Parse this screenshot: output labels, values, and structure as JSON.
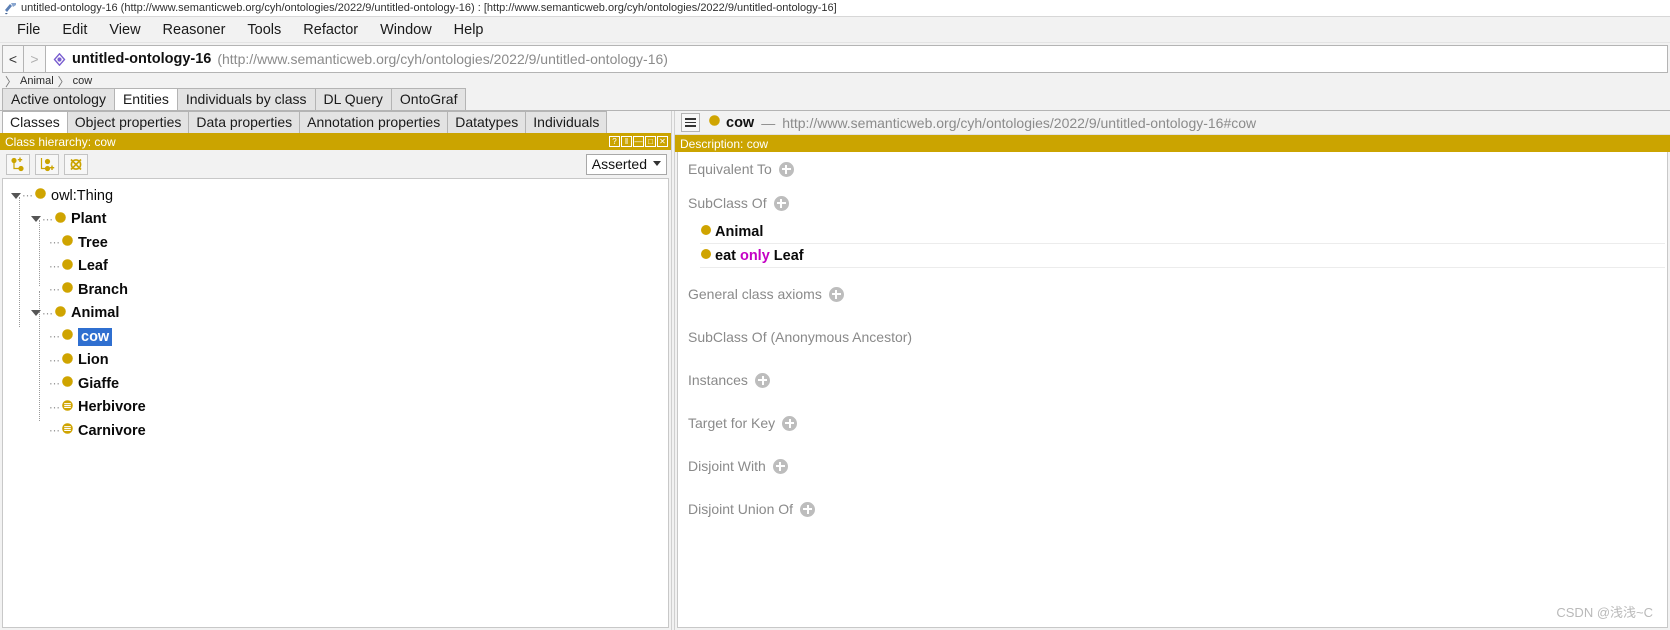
{
  "window": {
    "title": "untitled-ontology-16 (http://www.semanticweb.org/cyh/ontologies/2022/9/untitled-ontology-16)  : [http://www.semanticweb.org/cyh/ontologies/2022/9/untitled-ontology-16]",
    "app_icon": "protege-icon"
  },
  "menubar": {
    "items": [
      {
        "label": "File"
      },
      {
        "label": "Edit"
      },
      {
        "label": "View"
      },
      {
        "label": "Reasoner"
      },
      {
        "label": "Tools"
      },
      {
        "label": "Refactor"
      },
      {
        "label": "Window"
      },
      {
        "label": "Help"
      }
    ]
  },
  "iri_bar": {
    "back_label": "<",
    "forward_label": ">",
    "ontology_name": "untitled-ontology-16",
    "ontology_iri": "(http://www.semanticweb.org/cyh/ontologies/2022/9/untitled-ontology-16)"
  },
  "breadcrumb": {
    "sep": "〉",
    "items": [
      {
        "label": "Animal"
      },
      {
        "label": "cow"
      }
    ]
  },
  "tabs": {
    "items": [
      {
        "label": "Active ontology",
        "active": false
      },
      {
        "label": "Entities",
        "active": true
      },
      {
        "label": "Individuals by class",
        "active": false
      },
      {
        "label": "DL Query",
        "active": false
      },
      {
        "label": "OntoGraf",
        "active": false
      }
    ]
  },
  "subtabs": {
    "items": [
      {
        "label": "Classes",
        "active": true
      },
      {
        "label": "Object properties",
        "active": false
      },
      {
        "label": "Data properties",
        "active": false
      },
      {
        "label": "Annotation properties",
        "active": false
      },
      {
        "label": "Datatypes",
        "active": false
      },
      {
        "label": "Individuals",
        "active": false
      }
    ]
  },
  "class_hierarchy": {
    "header_title": "Class hierarchy: cow",
    "header_buttons": [
      "?",
      "‖",
      "—",
      "□",
      "✕"
    ],
    "toolbar": [
      {
        "name": "add-subclass-button",
        "icon": "add-subclass-icon"
      },
      {
        "name": "add-sibling-class-button",
        "icon": "add-sibling-icon"
      },
      {
        "name": "delete-class-button",
        "icon": "delete-class-icon"
      }
    ],
    "view_mode": "Asserted",
    "tree": [
      {
        "label": "owl:Thing",
        "depth": 0,
        "bold": false,
        "expanded": true,
        "icon": "class-icon",
        "selected": false
      },
      {
        "label": "Plant",
        "depth": 1,
        "bold": true,
        "expanded": true,
        "icon": "class-icon",
        "selected": false
      },
      {
        "label": "Tree",
        "depth": 2,
        "bold": true,
        "expanded": false,
        "icon": "class-icon",
        "selected": false
      },
      {
        "label": "Leaf",
        "depth": 2,
        "bold": true,
        "expanded": false,
        "icon": "class-icon",
        "selected": false
      },
      {
        "label": "Branch",
        "depth": 2,
        "bold": true,
        "expanded": false,
        "icon": "class-icon",
        "selected": false
      },
      {
        "label": "Animal",
        "depth": 1,
        "bold": true,
        "expanded": true,
        "icon": "class-icon",
        "selected": false
      },
      {
        "label": "cow",
        "depth": 2,
        "bold": true,
        "expanded": false,
        "icon": "class-icon",
        "selected": true
      },
      {
        "label": "Lion",
        "depth": 2,
        "bold": true,
        "expanded": false,
        "icon": "class-icon",
        "selected": false
      },
      {
        "label": "Giaffe",
        "depth": 2,
        "bold": true,
        "expanded": false,
        "icon": "class-icon",
        "selected": false
      },
      {
        "label": "Herbivore",
        "depth": 2,
        "bold": true,
        "expanded": false,
        "icon": "defined-class-icon",
        "selected": false
      },
      {
        "label": "Carnivore",
        "depth": 2,
        "bold": true,
        "expanded": false,
        "icon": "defined-class-icon",
        "selected": false
      }
    ]
  },
  "entity_bar": {
    "menu_icon": "hamburger-icon",
    "entity_icon": "class-icon",
    "entity_name": "cow",
    "dash": "—",
    "entity_iri": "http://www.semanticweb.org/cyh/ontologies/2022/9/untitled-ontology-16#cow"
  },
  "description": {
    "header_title": "Description: cow",
    "sections": [
      {
        "title": "Equivalent To",
        "has_add": true,
        "rows": []
      },
      {
        "title": "SubClass Of",
        "has_add": true,
        "rows": [
          {
            "parts": [
              {
                "text": "Animal",
                "kind": "entity"
              }
            ]
          },
          {
            "parts": [
              {
                "text": "eat",
                "kind": "entity"
              },
              {
                "text": "only",
                "kind": "keyword"
              },
              {
                "text": "Leaf",
                "kind": "entity"
              }
            ]
          }
        ]
      },
      {
        "title": "General class axioms",
        "has_add": true,
        "rows": []
      },
      {
        "title": "SubClass Of (Anonymous Ancestor)",
        "has_add": false,
        "rows": []
      },
      {
        "title": "Instances",
        "has_add": true,
        "rows": []
      },
      {
        "title": "Target for Key",
        "has_add": true,
        "rows": []
      },
      {
        "title": "Disjoint With",
        "has_add": true,
        "rows": []
      },
      {
        "title": "Disjoint Union Of",
        "has_add": true,
        "rows": []
      }
    ]
  },
  "watermark": {
    "text": "CSDN @浅浅~C"
  },
  "colors": {
    "gold": "#cba400",
    "class_yellow": "#cfa400",
    "selection_blue": "#2f6fd0",
    "keyword_magenta": "#c400c4",
    "muted_text": "#8a8a8a"
  }
}
